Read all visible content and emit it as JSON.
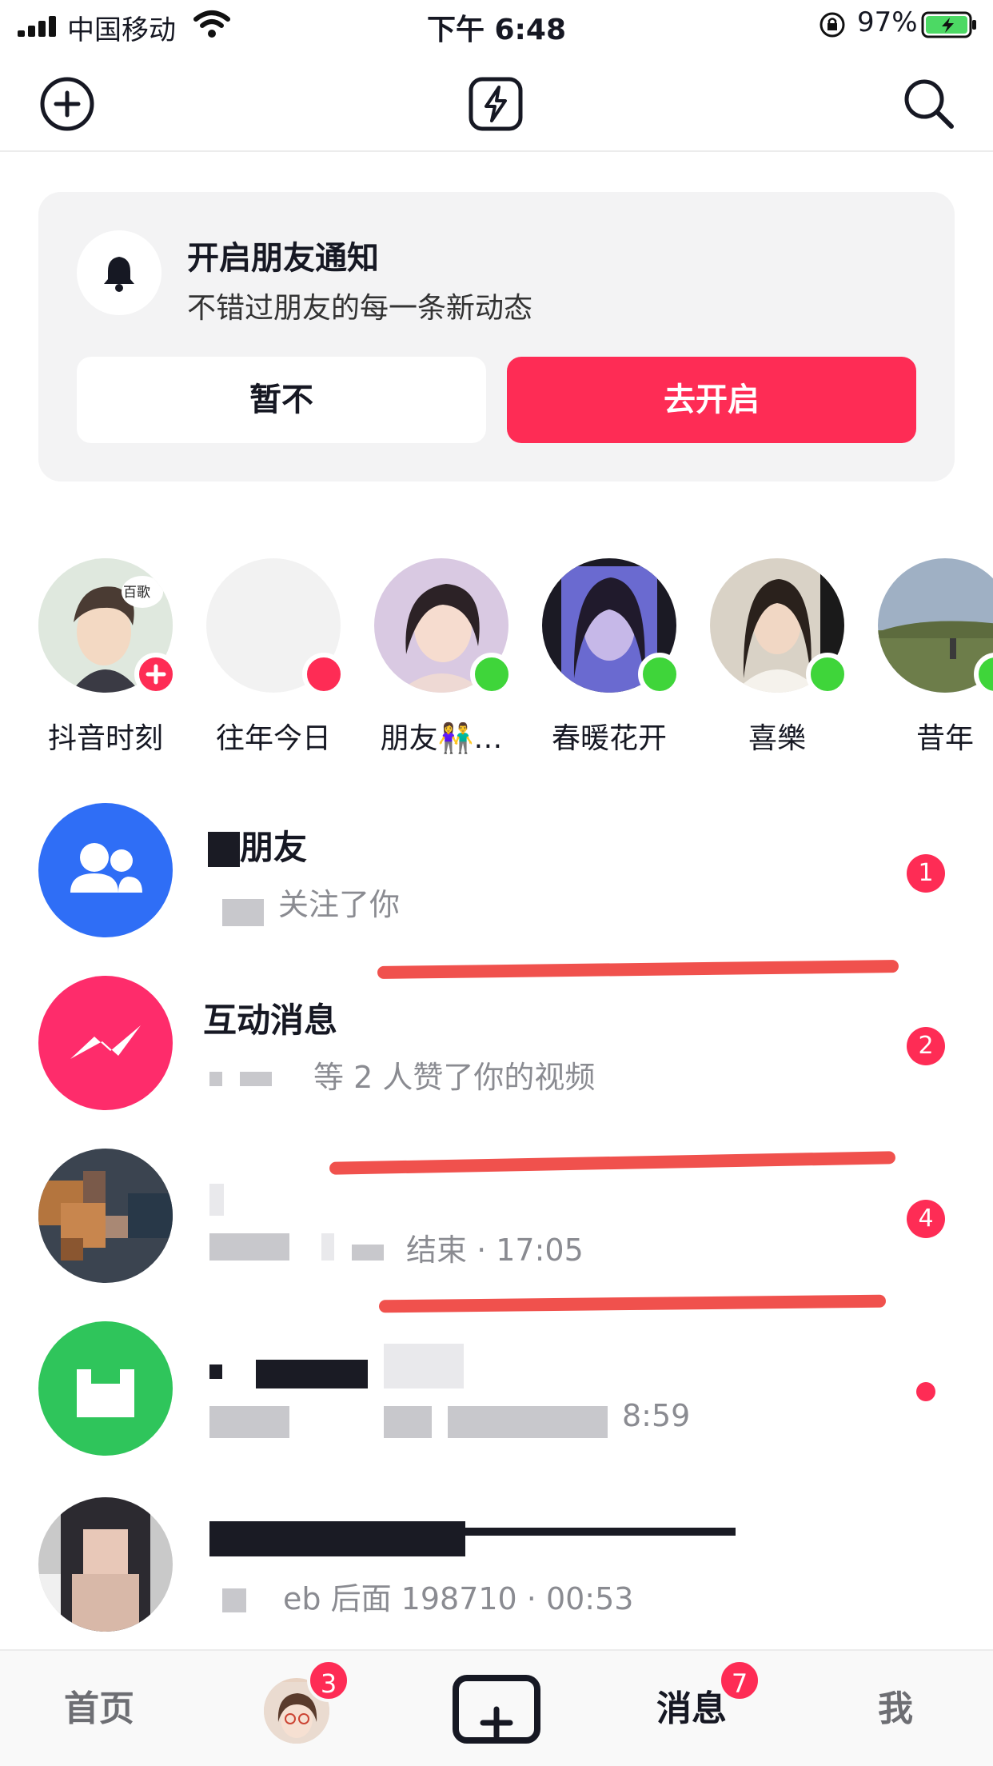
{
  "status_bar": {
    "carrier": "中国移动",
    "time": "下午 6:48",
    "battery": "97%"
  },
  "top_nav": {
    "left_icon": "add-circle-icon",
    "center_icon": "lightning-icon",
    "right_icon": "search-icon"
  },
  "notice": {
    "title": "开启朋友通知",
    "subtitle": "不错过朋友的每一条新动态",
    "later_label": "暂不",
    "enable_label": "去开启"
  },
  "stories": [
    {
      "label": "抖音时刻",
      "status": "add",
      "avatar_text": "百歌"
    },
    {
      "label": "往年今日",
      "status": "new"
    },
    {
      "label": "朋友👫…",
      "status": "online"
    },
    {
      "label": "春暖花开",
      "status": "online"
    },
    {
      "label": "喜樂",
      "status": "online"
    },
    {
      "label": "昔年",
      "status": "online"
    }
  ],
  "messages": [
    {
      "name": "朋友",
      "preview": "关注了你",
      "badge": "1"
    },
    {
      "name": "互动消息",
      "preview": "等 2 人赞了你的视频",
      "badge": "2"
    },
    {
      "name": "",
      "preview": "结束 · 17:05",
      "badge": "4"
    },
    {
      "name": "",
      "preview": "8:59",
      "badge": ""
    },
    {
      "name": "",
      "preview": "eb 后面 198710 · 00:53",
      "badge": ""
    }
  ],
  "tabs": {
    "home": "首页",
    "friends_badge": "3",
    "messages": "消息",
    "messages_badge": "7",
    "me": "我"
  },
  "colors": {
    "accent": "#fe2c55",
    "online": "#3fd53a",
    "friends_icon_bg": "#2f6ef6",
    "interact_icon_bg": "#fe2c6b",
    "wechat_green": "#2fc55b"
  }
}
